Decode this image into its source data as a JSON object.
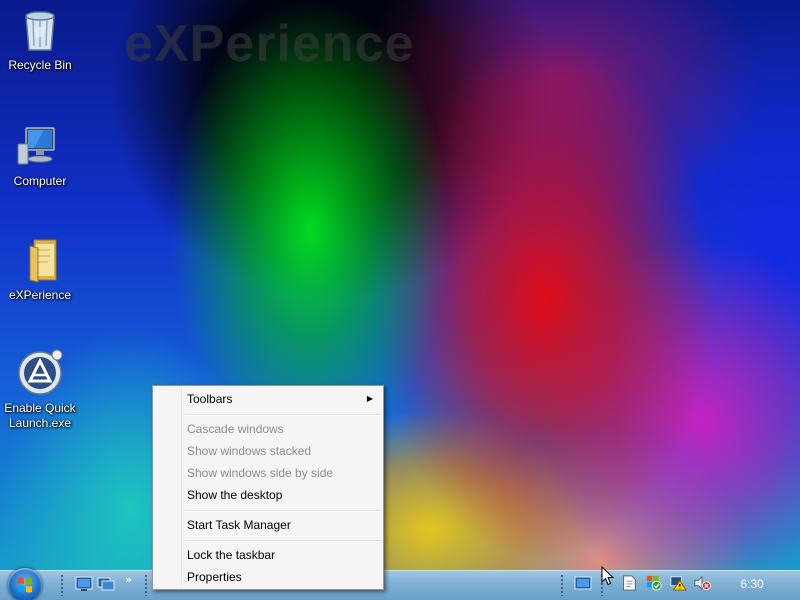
{
  "wallpaper": {
    "watermark_text": "eXPerience"
  },
  "desktop_icons": [
    {
      "label": "Recycle Bin",
      "icon": "recycle-bin-icon"
    },
    {
      "label": "Computer",
      "icon": "computer-icon"
    },
    {
      "label": "eXPerience",
      "icon": "folder-icon"
    },
    {
      "label": "Enable Quick\nLaunch.exe",
      "icon": "app-launcher-icon"
    }
  ],
  "context_menu": {
    "items": [
      {
        "label": "Toolbars",
        "mnemonic": "T",
        "enabled": true,
        "has_submenu": true
      },
      {
        "label": "Cascade windows",
        "mnemonic": "d",
        "enabled": false
      },
      {
        "label": "Show windows stacked",
        "mnemonic": "t",
        "enabled": false
      },
      {
        "label": "Show windows side by side",
        "mnemonic": "i",
        "enabled": false
      },
      {
        "label": "Show the desktop",
        "mnemonic": "S",
        "enabled": true
      },
      {
        "label": "Start Task Manager",
        "mnemonic": "k",
        "enabled": true
      },
      {
        "label": "Lock the taskbar",
        "mnemonic": "L",
        "enabled": true
      },
      {
        "label": "Properties",
        "mnemonic": "r",
        "enabled": true
      }
    ]
  },
  "taskbar": {
    "start_button_icon": "windows-logo-icon",
    "quick_launch_icons": [
      "show-desktop-icon",
      "switch-windows-icon"
    ],
    "overflow_chevron": "»",
    "tray_icons": [
      "desktop-toolbar-icon",
      "document-icon",
      "security-center-icon",
      "network-warning-icon",
      "volume-muted-icon"
    ],
    "clock": "6:30"
  },
  "colors": {
    "taskbar": "#7fb0d4",
    "menu_background": "#f5f5f5",
    "menu_disabled_text": "#8d8d8d"
  }
}
